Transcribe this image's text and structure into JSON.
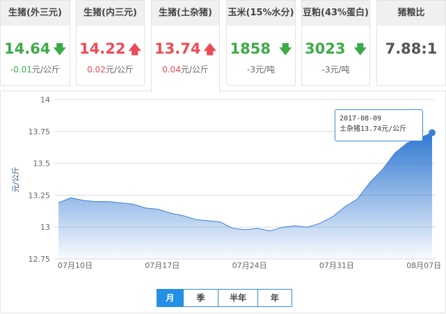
{
  "cards": [
    {
      "title": "生猪(外三元)",
      "value": "14.64",
      "change": "-0.01",
      "unit": "元/公斤",
      "trend": "down"
    },
    {
      "title": "生猪(内三元)",
      "value": "14.22",
      "change": "0.02",
      "unit": "元/公斤",
      "trend": "up"
    },
    {
      "title": "生猪(土杂猪)",
      "value": "13.74",
      "change": "0.04",
      "unit": "元/公斤",
      "trend": "up"
    },
    {
      "title": "玉米(15%水分)",
      "value": "1858",
      "change": "-3",
      "unit": "元/吨",
      "trend": "down"
    },
    {
      "title": "豆粕(43%蛋白)",
      "value": "3023",
      "change": "-3",
      "unit": "元/吨",
      "trend": "down"
    },
    {
      "title": "猪粮比",
      "value": "7.88:1"
    }
  ],
  "colors": {
    "up": "#ee4a55",
    "down": "#3daa4a",
    "line": "#3c7fd6",
    "accent": "#2190e6"
  },
  "tooltip": {
    "date": "2017-08-09",
    "text": "土杂猪13.74元/公斤"
  },
  "range_buttons": [
    "月",
    "季",
    "半年",
    "年"
  ],
  "range_selected": "月",
  "chart_data": {
    "type": "area",
    "ylabel": "元/公斤",
    "ylim": [
      12.75,
      14
    ],
    "yticks": [
      "12.75",
      "13",
      "13.25",
      "13.5",
      "13.75",
      "14"
    ],
    "xticks": [
      "07月10日",
      "07月17日",
      "07月24日",
      "07月31日",
      "08月07日"
    ],
    "x_start": "2017-07-10",
    "x_end": "2017-08-09",
    "grid": true,
    "values": [
      13.19,
      13.23,
      13.21,
      13.2,
      13.2,
      13.19,
      13.18,
      13.15,
      13.14,
      13.11,
      13.09,
      13.06,
      13.05,
      13.04,
      12.99,
      12.98,
      12.99,
      12.97,
      13.0,
      13.01,
      13.0,
      13.03,
      13.08,
      13.16,
      13.22,
      13.35,
      13.45,
      13.58,
      13.66,
      13.7,
      13.74
    ]
  }
}
